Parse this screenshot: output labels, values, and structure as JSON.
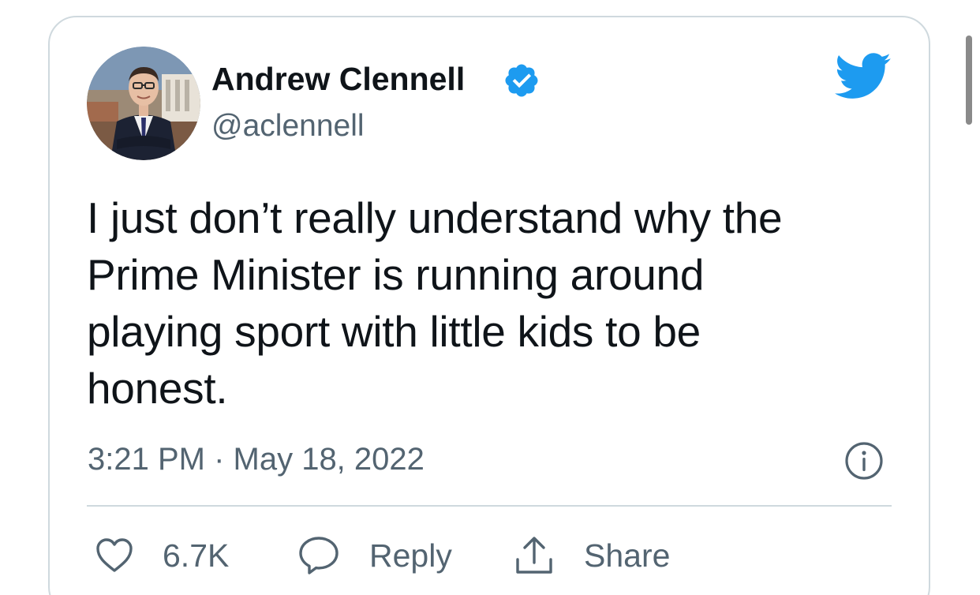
{
  "author": {
    "display_name": "Andrew Clennell",
    "handle": "@aclennell",
    "verified": true
  },
  "tweet": {
    "text_lines": [
      "I just don’t really understand why the",
      "Prime Minister is running around",
      "playing sport with little kids to be",
      "honest."
    ],
    "timestamp": "3:21 PM · May 18, 2022"
  },
  "actions": {
    "like_count": "6.7K",
    "reply_label": "Reply",
    "share_label": "Share"
  },
  "icons": {
    "verified": "verified-badge-icon",
    "brand": "twitter-bird-icon",
    "info": "info-icon",
    "like": "heart-icon",
    "reply": "speech-bubble-icon",
    "share": "share-arrow-icon"
  },
  "colors": {
    "twitter_blue": "#1d9bf0",
    "text_primary": "#0f1419",
    "text_secondary": "#536471",
    "border": "#cfd9de"
  }
}
